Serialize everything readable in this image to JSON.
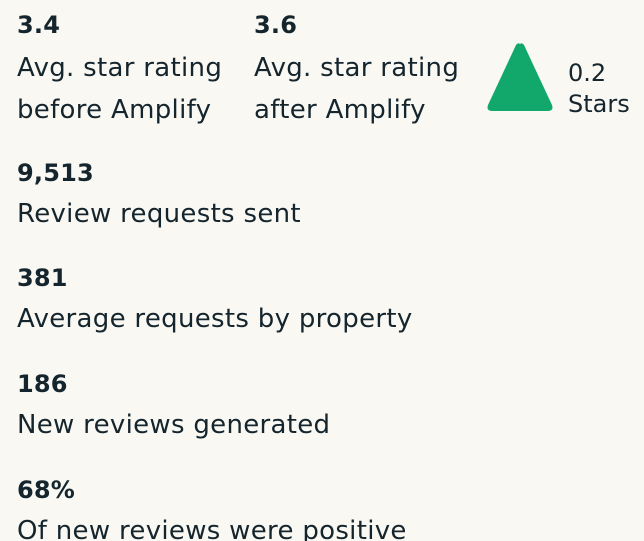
{
  "ratings": {
    "before": {
      "value": "3.4",
      "label_line1": "Avg. star rating",
      "label_line2": "before Amplify"
    },
    "after": {
      "value": "3.6",
      "label_line1": "Avg. star rating",
      "label_line2": "after Amplify"
    },
    "delta": {
      "value": "0.2",
      "unit": "Stars",
      "direction": "up",
      "color": "#13a86b",
      "icon": "triangle-up-icon"
    }
  },
  "stats": {
    "requests": {
      "value": "9,513",
      "label": "Review requests sent"
    },
    "avg_requests": {
      "value": "381",
      "label": "Average requests by property"
    },
    "new_reviews": {
      "value": "186",
      "label": "New reviews generated"
    },
    "positive": {
      "value": "68%",
      "label": "Of new reviews were positive"
    }
  },
  "colors": {
    "background": "#f9f8f3",
    "text": "#15252d",
    "accent": "#13a86b"
  }
}
